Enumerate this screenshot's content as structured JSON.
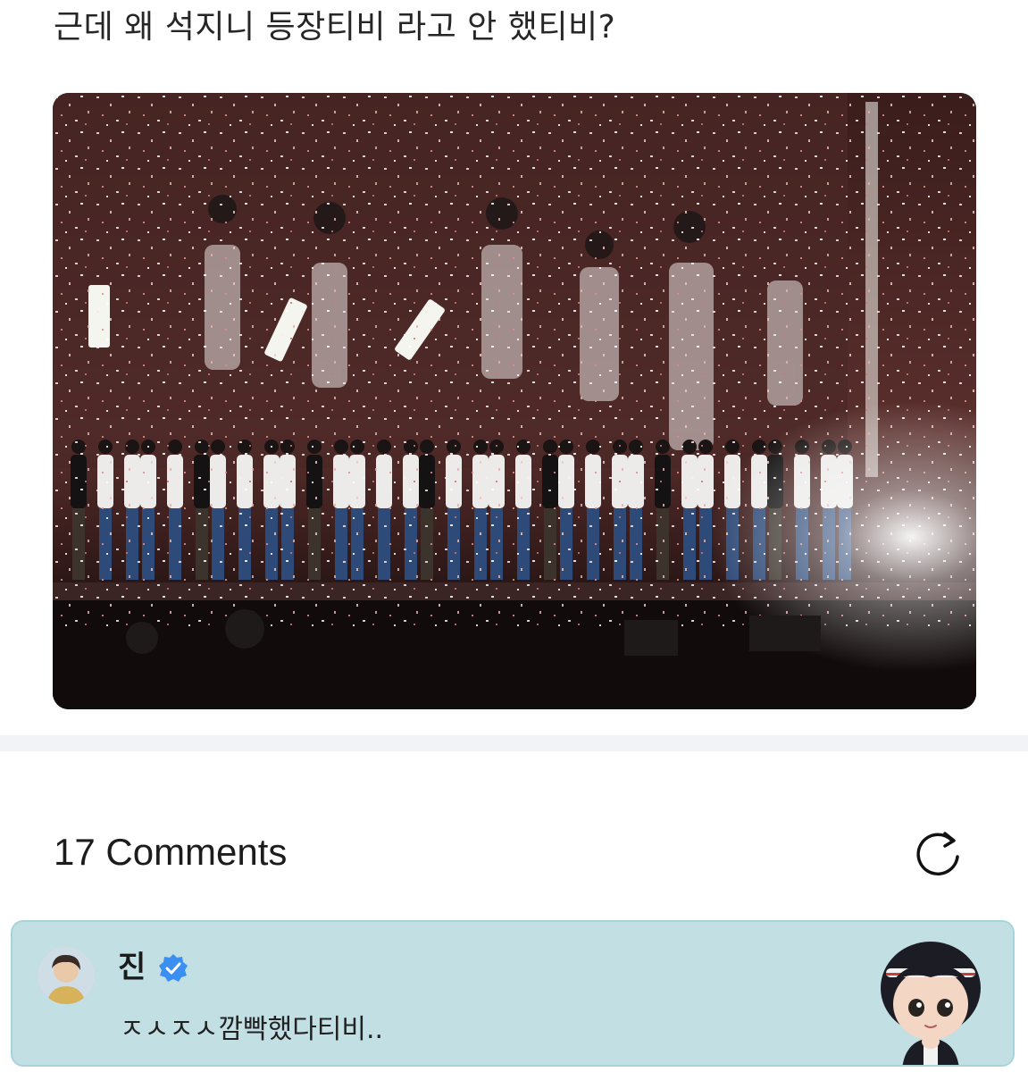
{
  "post": {
    "text": "근데 왜 석지니 등장티비 라고 안 했티비?",
    "image_icon": "concert-stage-photo"
  },
  "comments": {
    "header": "17 Comments",
    "refresh_icon": "refresh-icon",
    "items": [
      {
        "author": "진",
        "verified": true,
        "text": "ㅈㅅㅈㅅ깜빡했다티비..",
        "avatar_icon": "avatar-photo",
        "sticker_icon": "character-sticker"
      }
    ]
  },
  "colors": {
    "card_background": "#c2dfe4",
    "card_border": "#a9d3dc",
    "verified_badge": "#3b8ff0",
    "divider": "#f2f3f7"
  }
}
